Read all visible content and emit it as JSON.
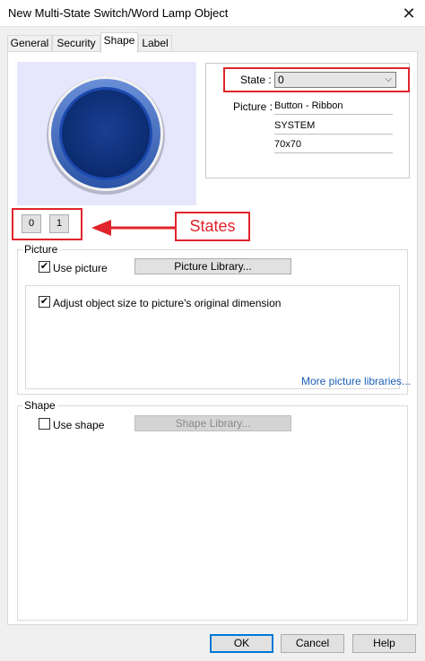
{
  "window": {
    "title": "New Multi-State Switch/Word Lamp Object",
    "close_glyph": "✕"
  },
  "tabs": [
    {
      "label": "General",
      "active": false
    },
    {
      "label": "Security",
      "active": false
    },
    {
      "label": "Shape",
      "active": true
    },
    {
      "label": "Label",
      "active": false
    }
  ],
  "state": {
    "label": "State :",
    "value": "0",
    "dropdown_icon": "chevron-down-icon"
  },
  "picture_info": {
    "label": "Picture :",
    "name": "Button - Ribbon",
    "library": "SYSTEM",
    "size": "70x70"
  },
  "state_buttons": [
    "0",
    "1"
  ],
  "annotation": {
    "text": "States",
    "color": "#e0242b"
  },
  "picture_group": {
    "title": "Picture",
    "use_picture_label": "Use picture",
    "use_picture_checked": true,
    "library_button": "Picture Library...",
    "adjust_label": "Adjust object size to picture's original dimension",
    "adjust_checked": true,
    "more_link": "More picture libraries..."
  },
  "shape_group": {
    "title": "Shape",
    "use_shape_label": "Use shape",
    "use_shape_checked": false,
    "library_button": "Shape Library..."
  },
  "footer": {
    "ok": "OK",
    "cancel": "Cancel",
    "help": "Help"
  },
  "colors": {
    "preview_bg": "#e6e7fd",
    "button_blue": "#1f4fa0",
    "accent_red": "#e0242b",
    "link_blue": "#1a5fb4"
  }
}
